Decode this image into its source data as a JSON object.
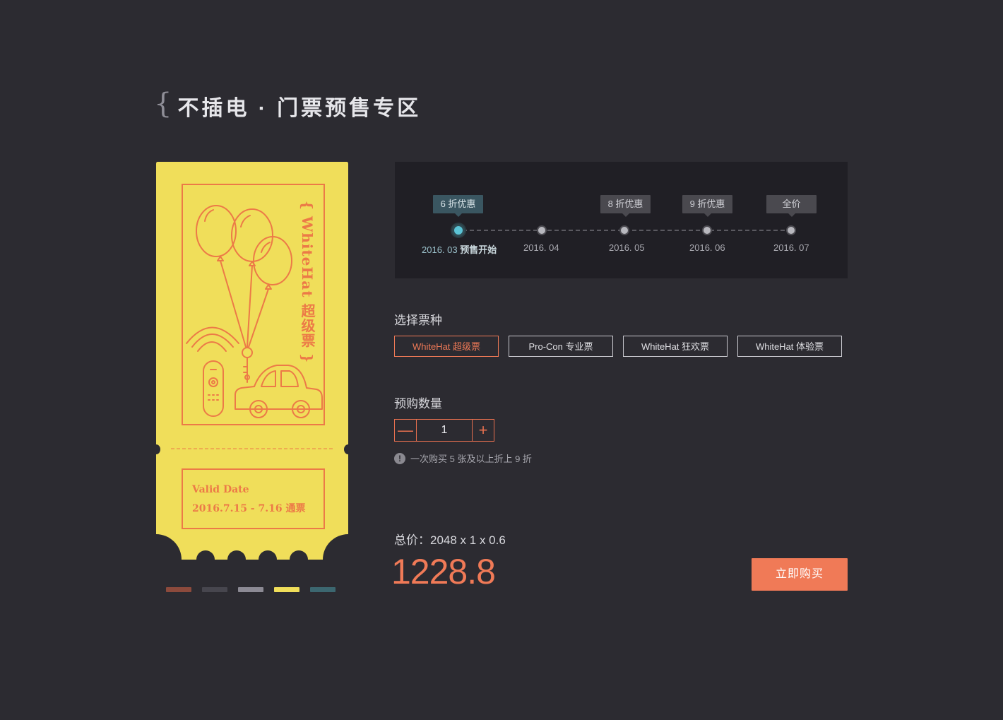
{
  "page": {
    "title": "不插电 · 门票预售专区"
  },
  "ticket": {
    "brand": "{ WhiteHat 超级票 }",
    "valid_label": "Valid Date",
    "valid_date": "2016.7.15 - 7.16 通票",
    "colors": {
      "body": "#f0de5a",
      "accent": "#ec7a47"
    },
    "swatches": [
      "#8c4a3c",
      "#47464e",
      "#8c8a94",
      "#f0de5a",
      "#3c6770"
    ]
  },
  "timeline": {
    "tags": [
      {
        "label": "6 折优惠",
        "active": true
      },
      {
        "label": "8 折优惠",
        "active": false
      },
      {
        "label": "9 折优惠",
        "active": false
      },
      {
        "label": "全价",
        "active": false
      }
    ],
    "dates": [
      {
        "date": "2016. 03",
        "note": "预售开始",
        "active": true
      },
      {
        "date": "2016. 04",
        "note": "",
        "active": false
      },
      {
        "date": "2016. 05",
        "note": "",
        "active": false
      },
      {
        "date": "2016. 06",
        "note": "",
        "active": false
      },
      {
        "date": "2016. 07",
        "note": "",
        "active": false
      }
    ]
  },
  "ticket_type": {
    "label": "选择票种",
    "options": [
      {
        "label": "WhiteHat 超级票",
        "selected": true
      },
      {
        "label": "Pro-Con 专业票",
        "selected": false
      },
      {
        "label": "WhiteHat 狂欢票",
        "selected": false
      },
      {
        "label": "WhiteHat 体验票",
        "selected": false
      }
    ]
  },
  "quantity": {
    "label": "预购数量",
    "minus": "—",
    "plus": "+",
    "value": "1",
    "hint": "一次购买 5 张及以上折上 9 折",
    "hint_icon": "!"
  },
  "total": {
    "formula": "总价：2048 x 1 x 0.6",
    "price": "1228.8",
    "buy_label": "立即购买"
  },
  "colors": {
    "background": "#2c2b31",
    "panel": "#201f25",
    "accent": "#f07a57",
    "active": "#5bc4d6"
  }
}
